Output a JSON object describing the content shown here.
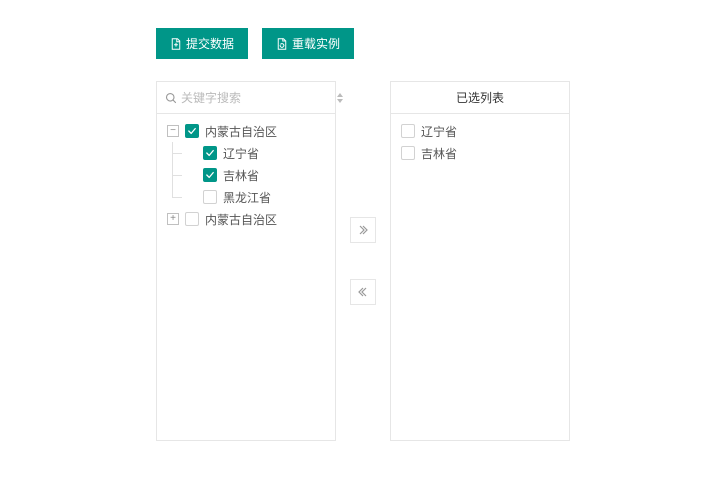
{
  "toolbar": {
    "submit_label": "提交数据",
    "reload_label": "重载实例"
  },
  "search": {
    "placeholder": "关键字搜索"
  },
  "tree": {
    "items": [
      {
        "label": "内蒙古自治区",
        "toggle": "−",
        "checked": true
      },
      {
        "label": "辽宁省",
        "checked": true
      },
      {
        "label": "吉林省",
        "checked": true
      },
      {
        "label": "黑龙江省",
        "checked": false
      },
      {
        "label": "内蒙古自治区",
        "toggle": "+",
        "checked": false
      }
    ]
  },
  "selected": {
    "header": "已选列表",
    "items": [
      {
        "label": "辽宁省"
      },
      {
        "label": "吉林省"
      }
    ]
  }
}
